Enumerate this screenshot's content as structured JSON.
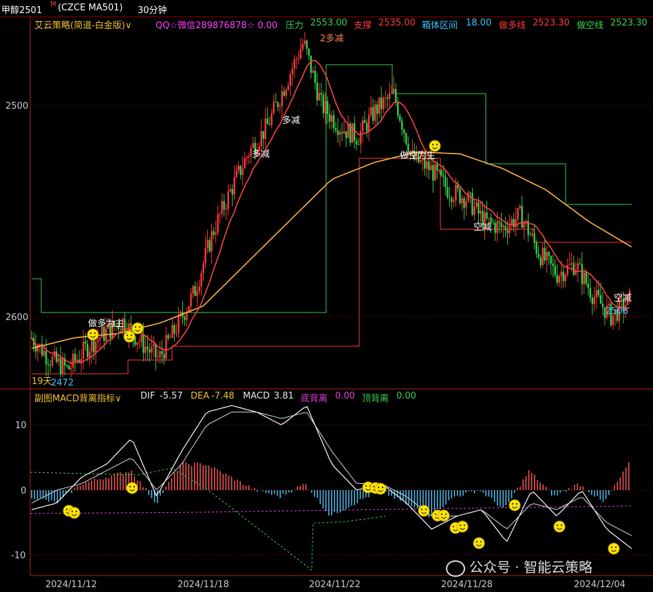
{
  "header": {
    "symbol": "甲醇2501",
    "badge": "M",
    "code": "(CZCE MA501)",
    "period": "30分钟"
  },
  "main_indicator": {
    "name": "艾云策略(简道-白金版)∨",
    "contact": "QQ☆微信289876878☆ 0.00",
    "items": [
      {
        "label": "压力",
        "value": "2553.00",
        "color": "#39d14b"
      },
      {
        "label": "支撑",
        "value": "2535.00",
        "color": "#ff3b3b"
      },
      {
        "label": "箱体区间",
        "value": "18.00",
        "color": "#39c6ff"
      },
      {
        "label": "做多线",
        "value": "2523.30",
        "color": "#ff3b3b"
      },
      {
        "label": "做空线",
        "value": "2523.30",
        "color": "#39d14b"
      }
    ]
  },
  "sub_indicator": {
    "name": "副图MACD背离指标∨",
    "items": [
      {
        "label": "DIF",
        "value": "-5.57",
        "color": "#e6e6e6"
      },
      {
        "label": "DEA",
        "value": "-7.48",
        "color": "#f1c232"
      },
      {
        "label": "MACD",
        "value": "3.81",
        "color": "#e6e6e6"
      },
      {
        "label": "底背离",
        "value": "0.00",
        "color": "#e040e0"
      },
      {
        "label": "顶背离",
        "value": "0.00",
        "color": "#39d14b"
      }
    ]
  },
  "annotations": {
    "top_label": "2多减",
    "duojian1": "多减",
    "duojian2": "多减",
    "zuokong": "做空为主",
    "zuoduo": "做多为主",
    "kongjian1": "空减",
    "kongjian2": "空减",
    "days": "19天",
    "low_value": "2472",
    "last_value": "2506"
  },
  "watermark": "公众号 · 智能云策略",
  "colors": {
    "up": "#ff3b3b",
    "down": "#39d14b",
    "slow_ma": "#ffb347",
    "fast_ma_up": "#ff3b3b",
    "fast_ma_down": "#7dff7d",
    "axis": "#b22222",
    "grid": "#8b0000",
    "smile": "#ffe600"
  },
  "chart_data": [
    {
      "type": "candlestick",
      "title": "甲醇2501 30分钟",
      "y_ticks": [
        2500,
        2600
      ],
      "ylim": [
        2450,
        2650
      ],
      "x_ticks": [
        "2024/11/12",
        "2024/11/18",
        "2024/11/22",
        "2024/11/28",
        "2024/12/04"
      ],
      "close_path": [
        2490,
        2480,
        2475,
        2485,
        2492,
        2498,
        2488,
        2480,
        2495,
        2512,
        2540,
        2560,
        2578,
        2590,
        2610,
        2630,
        2600,
        2590,
        2585,
        2598,
        2605,
        2575,
        2570,
        2560,
        2556,
        2545,
        2542,
        2548,
        2530,
        2520,
        2525,
        2510,
        2500,
        2508
      ],
      "slow_ma_path": [
        2485,
        2490,
        2492,
        2497,
        2505,
        2525,
        2545,
        2565,
        2573,
        2578,
        2577,
        2570,
        2560,
        2545,
        2533
      ],
      "range_lines": {
        "resistance": [
          2502,
          2620,
          2607,
          2570,
          2553
        ],
        "support": [
          2470,
          2494,
          2575,
          2540,
          2535
        ]
      }
    },
    {
      "type": "bar",
      "title": "MACD背离指标",
      "y_ticks": [
        10,
        0,
        -10
      ],
      "ylim": [
        -13,
        13
      ],
      "series": [
        {
          "name": "DIF",
          "values": [
            -3,
            -2,
            2,
            4,
            8,
            -1,
            6,
            12,
            13,
            12,
            10,
            13,
            4,
            0,
            1,
            -2,
            -6,
            -4,
            -3,
            -8,
            0,
            -4,
            0,
            -6,
            -9
          ]
        },
        {
          "name": "DEA",
          "values": [
            -2,
            0,
            1,
            3,
            5,
            0,
            4,
            10,
            12,
            12,
            11,
            12,
            6,
            1,
            1,
            -1,
            -4,
            -4,
            -3,
            -6,
            -2,
            -3,
            -1,
            -5,
            -7
          ]
        },
        {
          "name": "MACD",
          "values": [
            -1,
            -2,
            1,
            2,
            3,
            -2,
            4,
            4,
            2,
            0,
            -1,
            1,
            -4,
            -2,
            0,
            -2,
            -4,
            -1,
            0,
            -3,
            3,
            -1,
            1,
            -2,
            4
          ]
        }
      ]
    }
  ]
}
